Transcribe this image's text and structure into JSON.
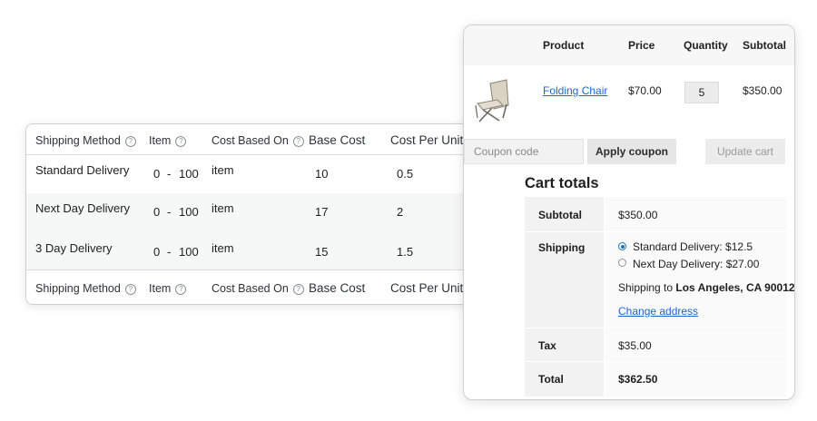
{
  "shipping_table": {
    "headers": {
      "method": "Shipping Method",
      "item": "Item",
      "cost_based_on": "Cost Based On",
      "base_cost": "Base Cost",
      "cost_per_unit": "Cost Per Unit"
    },
    "help_icon": "question-circle-icon",
    "help_glyph": "?",
    "range_separator": "-",
    "rows": [
      {
        "method": "Standard Delivery",
        "min": "0",
        "max": "100",
        "based_on": "item",
        "base_cost": "10",
        "per_unit": "0.5"
      },
      {
        "method": "Next Day Delivery",
        "min": "0",
        "max": "100",
        "based_on": "item",
        "base_cost": "17",
        "per_unit": "2"
      },
      {
        "method": "3 Day Delivery",
        "min": "0",
        "max": "100",
        "based_on": "item",
        "base_cost": "15",
        "per_unit": "1.5"
      }
    ]
  },
  "cart": {
    "headers": {
      "product": "Product",
      "price": "Price",
      "quantity": "Quantity",
      "subtotal": "Subtotal"
    },
    "item": {
      "name": "Folding Chair",
      "price": "$70.00",
      "quantity": "5",
      "subtotal": "$350.00",
      "thumbnail_icon": "folding-chair-image"
    },
    "coupon_placeholder": "Coupon code",
    "apply_coupon": "Apply coupon",
    "update_cart": "Update cart"
  },
  "cart_totals": {
    "title": "Cart totals",
    "subtotal_label": "Subtotal",
    "subtotal_value": "$350.00",
    "shipping_label": "Shipping",
    "options": [
      {
        "label": "Standard Delivery: $12.5",
        "selected": true
      },
      {
        "label": "Next Day Delivery: $27.00",
        "selected": false
      }
    ],
    "ship_to_prefix": "Shipping to",
    "ship_to_location": "Los Angeles, CA 90012",
    "ship_to_suffix": ".",
    "change_address": "Change address",
    "tax_label": "Tax",
    "tax_value": "$35.00",
    "total_label": "Total",
    "total_value": "$362.50"
  },
  "colors": {
    "link": "#1a66d6",
    "radio_accent": "#2271b1",
    "alt_row": "#f6f7f7"
  }
}
